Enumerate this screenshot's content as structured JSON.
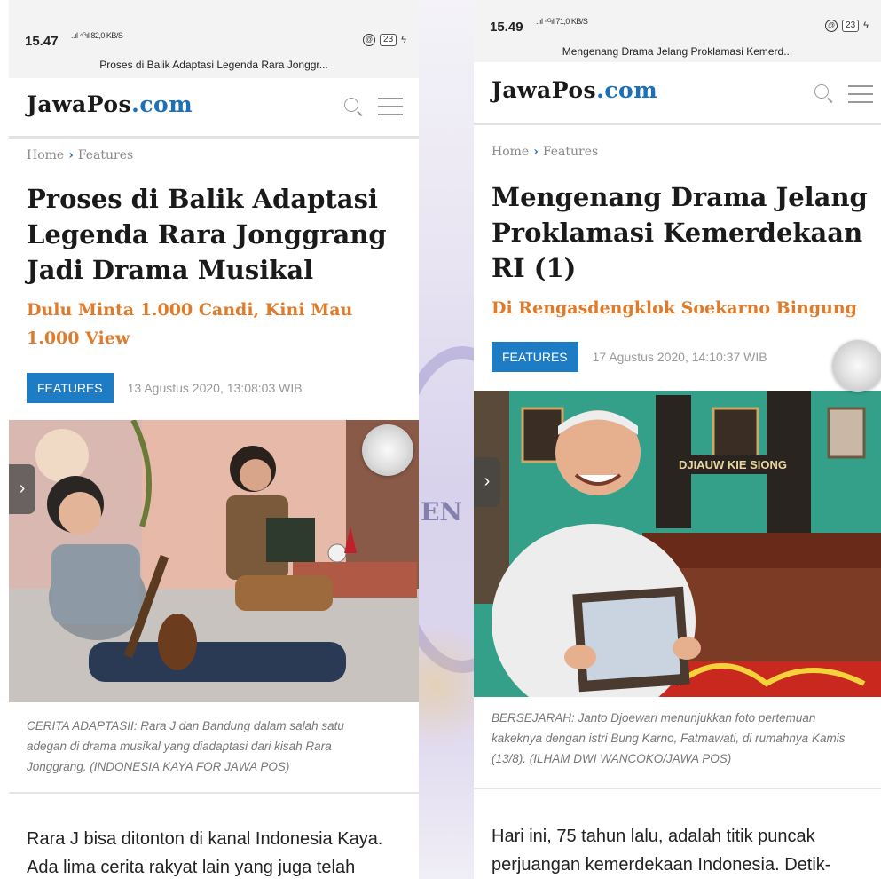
{
  "left": {
    "status": {
      "time": "15.47",
      "signal": "..ıl ⁴ᴳıl",
      "speed": "82,0 KB/S",
      "battery": "23"
    },
    "tab_title": "Proses di Balik Adaptasi Legenda Rara Jonggr...",
    "logo": {
      "main": "JawaPos",
      "tld": ".com"
    },
    "breadcrumb": {
      "home": "Home",
      "sep": "›",
      "section": "Features"
    },
    "headline": "Proses di Balik Adaptasi Legenda Rara Jonggrang Jadi Drama Musikal",
    "subheadline": "Dulu Minta 1.000 Candi, Kini Mau 1.000 View",
    "category": "FEATURES",
    "date": "13 Agustus 2020, 13:08:03 WIB",
    "caption": "CERITA ADAPTASII: Rara J dan Bandung dalam salah satu adegan di drama musikal yang diadaptasi dari kisah Rara Jonggrang. (INDONESIA KAYA FOR JAWA POS)",
    "body": "Rara J bisa ditonton di kanal Indonesia Kaya. Ada lima cerita rakyat lain yang juga telah"
  },
  "right": {
    "status": {
      "time": "15.49",
      "signal": "..ıl ⁴ᴳıl",
      "speed": "71,0 KB/S",
      "battery": "23"
    },
    "tab_title": "Mengenang Drama Jelang Proklamasi Kemerd...",
    "logo": {
      "main": "JawaPos",
      "tld": ".com"
    },
    "breadcrumb": {
      "home": "Home",
      "sep": "›",
      "section": "Features"
    },
    "headline": "Mengenang Drama Jelang Proklamasi Kemerdekaan RI (1)",
    "subheadline": "Di Rengasdengklok Soekarno Bingung",
    "category": "FEATURES",
    "date": "17 Agustus 2020, 14:10:37 WIB",
    "photo_sign": "DJIAUW KIE SIONG",
    "caption": "BERSEJARAH: Janto Djoewari menunjukkan foto pertemuan kakeknya dengan istri Bung Karno, Fatmawati, di rumahnya Kamis (13/8). (ILHAM DWI WANCOKO/JAWA POS)",
    "body": "Hari ini, 75 tahun lalu, adalah titik puncak perjuangan kemerdekaan Indonesia. Detik-"
  },
  "icons": {
    "next": "›",
    "alarm": "@",
    "charge": "ϟ"
  },
  "colors": {
    "brand_blue": "#1d6fb7",
    "badge": "#1d7cc4",
    "accent_orange": "#e07b2a"
  }
}
